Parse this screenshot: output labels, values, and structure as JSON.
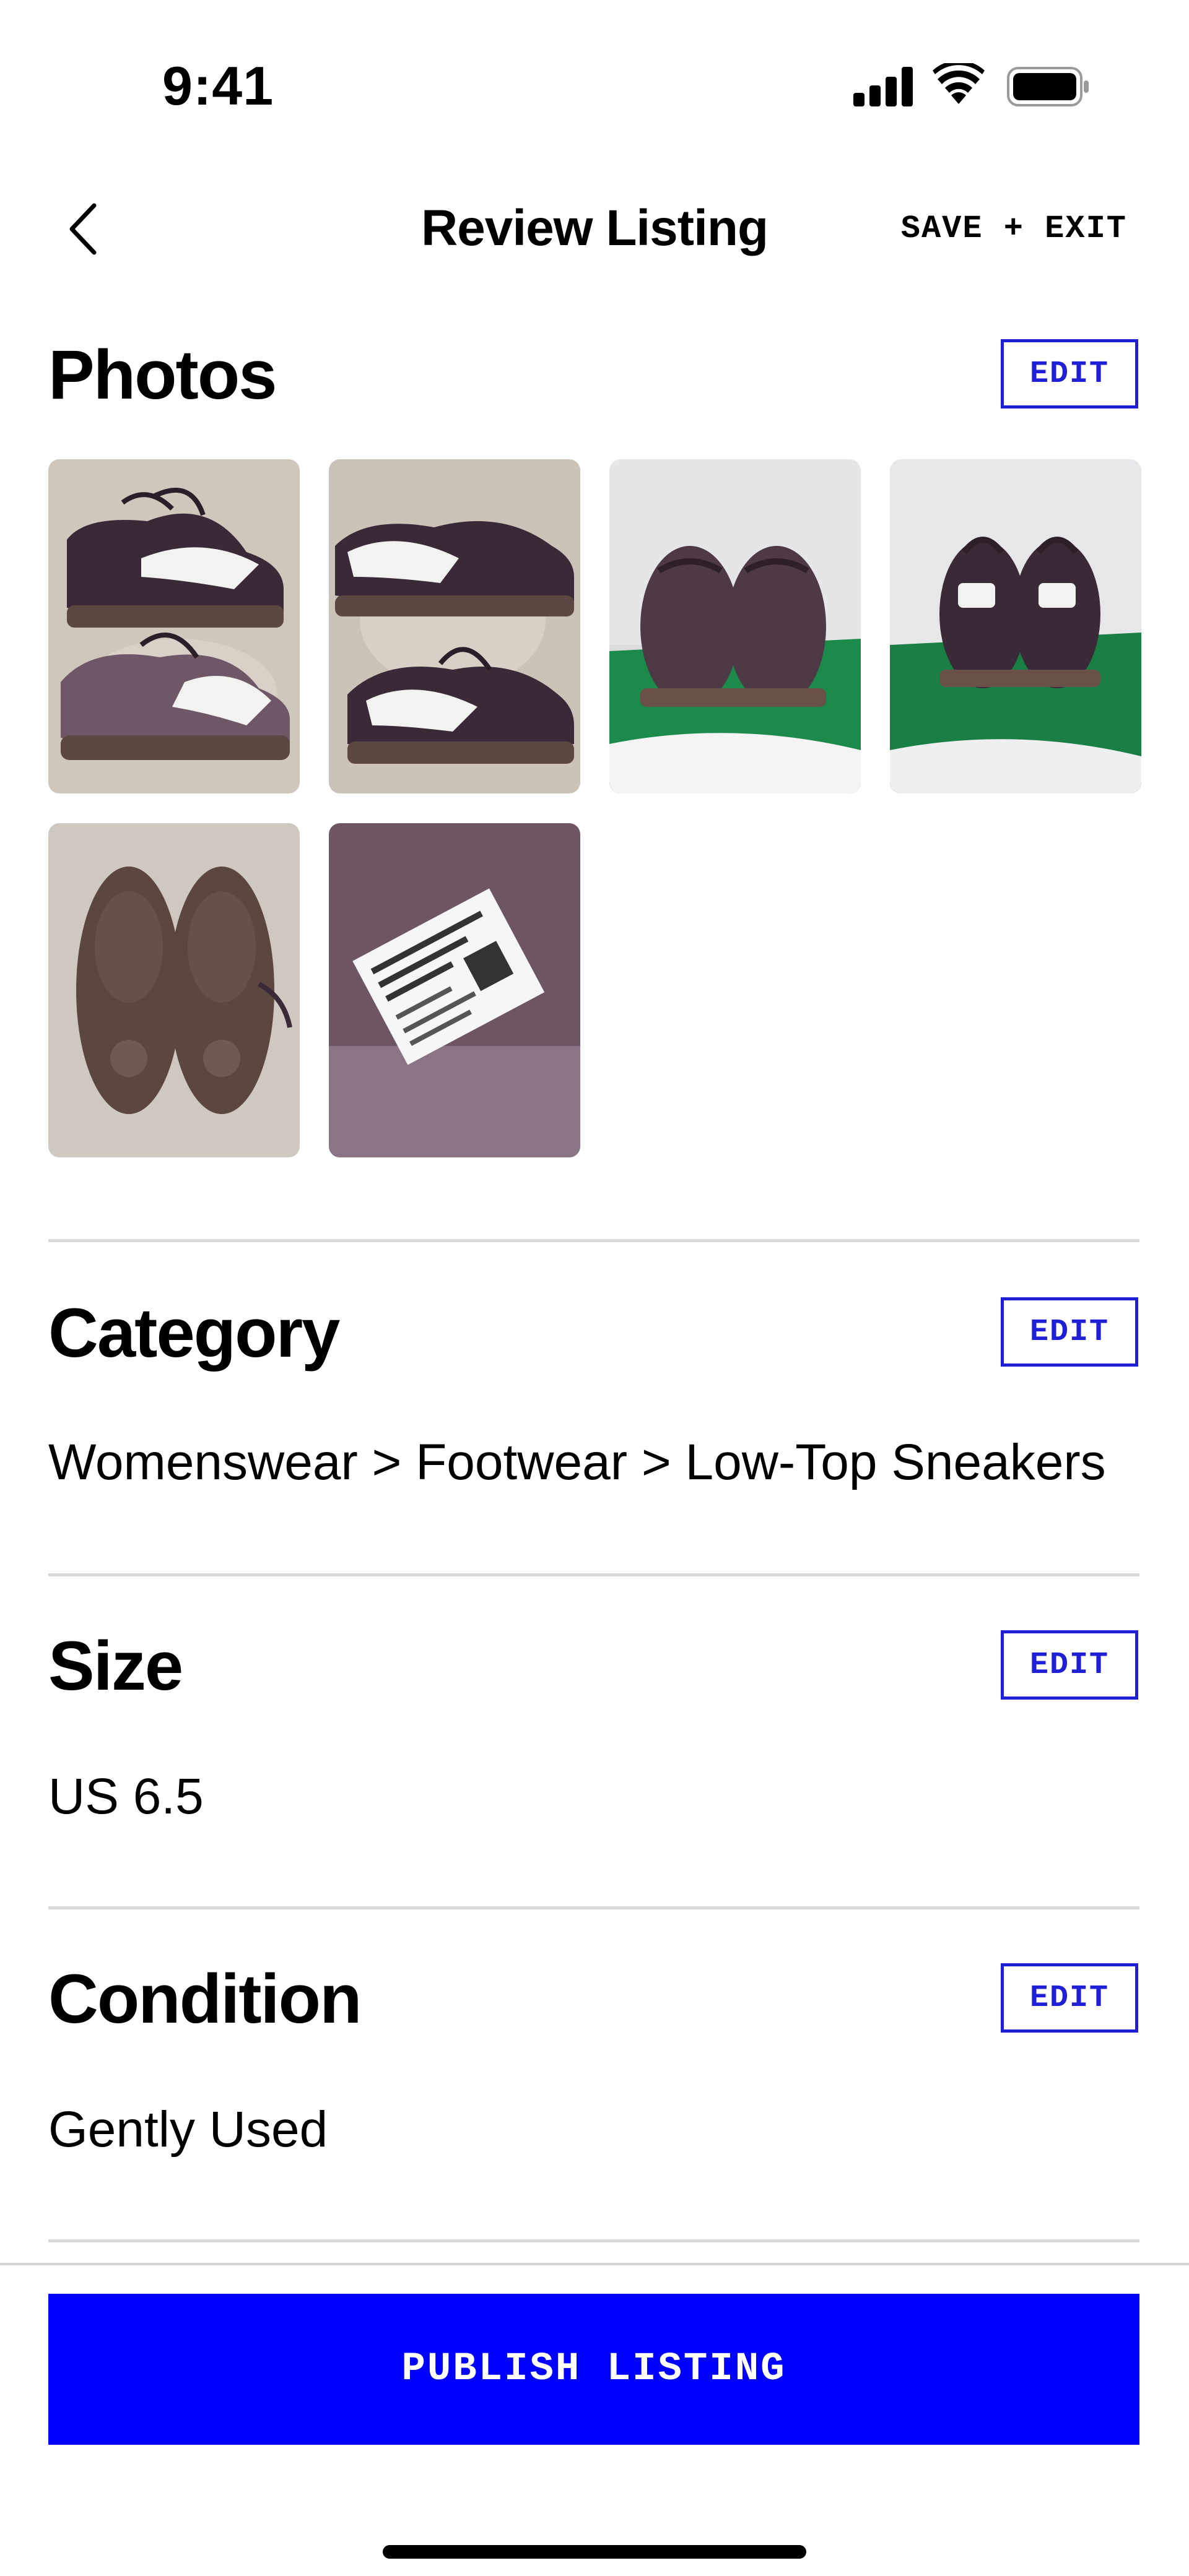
{
  "status_bar": {
    "time": "9:41",
    "icons": [
      "cellular-signal-icon",
      "wifi-icon",
      "battery-icon"
    ]
  },
  "nav": {
    "back_icon": "chevron-left-icon",
    "title": "Review Listing",
    "save_exit_label": "SAVE + EXIT"
  },
  "photos": {
    "title": "Photos",
    "edit_label": "EDIT",
    "items": [
      "sneaker-pair-side-photo",
      "sneaker-pair-side-photo-2",
      "sneaker-front-on-box-photo",
      "sneaker-back-on-box-photo",
      "sneaker-soles-photo",
      "sneaker-size-label-photo"
    ]
  },
  "category": {
    "title": "Category",
    "edit_label": "EDIT",
    "value": "Womenswear > Footwear > Low-Top Sneakers"
  },
  "size": {
    "title": "Size",
    "edit_label": "EDIT",
    "value": "US 6.5"
  },
  "condition": {
    "title": "Condition",
    "edit_label": "EDIT",
    "value": "Gently Used"
  },
  "footer": {
    "publish_label": "PUBLISH LISTING"
  },
  "colors": {
    "accent": "#0000FF",
    "edit_border": "#1F1FD6",
    "divider": "#D9D9D9"
  }
}
